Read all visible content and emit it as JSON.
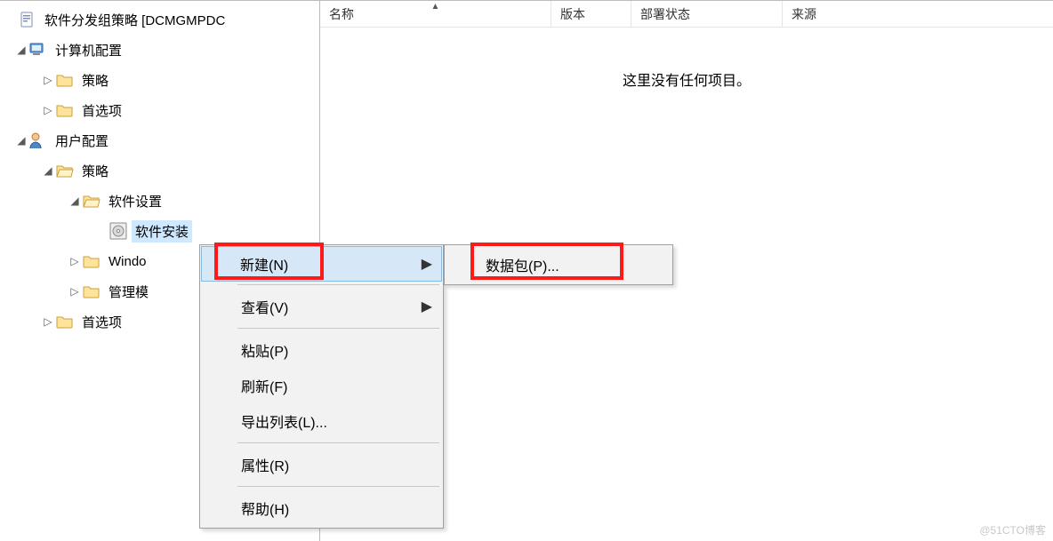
{
  "tree": {
    "root": "软件分发组策略 [DCMGMPDC",
    "computer_cfg": "计算机配置",
    "cc_policies": "策略",
    "cc_prefs": "首选项",
    "user_cfg": "用户配置",
    "uc_policies": "策略",
    "software_settings": "软件设置",
    "software_install": "软件安装",
    "windows_trunc": "Windo",
    "admin_templates": "管理模",
    "uc_prefs": "首选项"
  },
  "list": {
    "col_name": "名称",
    "col_version": "版本",
    "col_deploy_state": "部署状态",
    "col_source": "来源",
    "empty": "这里没有任何项目。"
  },
  "ctx": {
    "new": "新建(N)",
    "view": "查看(V)",
    "paste": "粘贴(P)",
    "refresh": "刷新(F)",
    "export_list": "导出列表(L)...",
    "properties": "属性(R)",
    "help": "帮助(H)"
  },
  "submenu": {
    "package": "数据包(P)..."
  },
  "watermark": "@51CTO博客"
}
